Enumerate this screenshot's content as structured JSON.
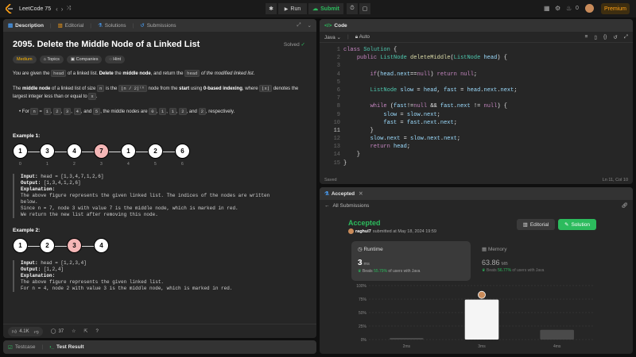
{
  "topbar": {
    "app_title": "LeetCode 75",
    "run_label": "Run",
    "submit_label": "Submit",
    "premium_label": "Premium",
    "avatar_count": "0"
  },
  "description_panel": {
    "tabs": [
      "Description",
      "Editorial",
      "Solutions",
      "Submissions"
    ],
    "title": "2095. Delete the Middle Node of a Linked List",
    "solved_label": "Solved",
    "chips": [
      "Medium",
      "Topics",
      "Companies",
      "Hint"
    ],
    "para1": {
      "t1": "You are given the ",
      "c1": "head",
      "t2": " of a linked list. ",
      "b1": "Delete",
      "t3": " the ",
      "b2": "middle node",
      "t4": ", and return the ",
      "c2": "head",
      "t5": " of the modified linked list."
    },
    "para2": {
      "t1": "The ",
      "b1": "middle node",
      "t2": " of a linked list of size ",
      "c1": "n",
      "t3": " is the ",
      "c2": "⌊n / 2⌋ᵗʰ",
      "t4": " node from the ",
      "b2": "start",
      "t5": " using ",
      "b3": "0-based indexing",
      "t6": ", where ",
      "c3": "⌊x⌋",
      "t7": " denotes the largest integer less than or equal to ",
      "c4": "x",
      "t8": "."
    },
    "bullet": {
      "t1": "For ",
      "c1": "n",
      "t2": " = ",
      "c2": "1",
      "c3": "2",
      "c4": "3",
      "c5": "4",
      "t3": ", and ",
      "c6": "5",
      "t4": ", the middle nodes are ",
      "c7": "0",
      "c8": "1",
      "c9": "1",
      "c10": "2",
      "t5": ", and ",
      "c11": "2",
      "t6": ", respectively."
    },
    "example1": {
      "title": "Example 1:",
      "nodes": [
        "1",
        "3",
        "4",
        "7",
        "1",
        "2",
        "6"
      ],
      "indices": [
        "0",
        "1",
        "2",
        "3",
        "4",
        "5",
        "6"
      ],
      "input_label": "Input:",
      "input_val": " head = [1,3,4,7,1,2,6]",
      "output_label": "Output:",
      "output_val": " [1,3,4,1,2,6]",
      "explanation_label": "Explanation:",
      "explanation_lines": [
        "The above figure represents the given linked list. The indices of the nodes are written",
        "below.",
        "Since n = 7, node 3 with value 7 is the middle node, which is marked in red.",
        "We return the new list after removing this node."
      ]
    },
    "example2": {
      "title": "Example 2:",
      "nodes": [
        "1",
        "2",
        "3",
        "4"
      ],
      "input_label": "Input:",
      "input_val": " head = [1,2,3,4]",
      "output_label": "Output:",
      "output_val": " [1,2,4]",
      "explanation_label": "Explanation:",
      "explanation_lines": [
        "The above figure represents the given linked list.",
        "For n = 4, node 2 with value 3 is the middle node, which is marked in red."
      ]
    },
    "footer": {
      "likes": "4.1K",
      "comments": "37"
    }
  },
  "bottom_tabs": [
    "Testcase",
    "Test Result"
  ],
  "code_panel": {
    "title": "Code",
    "language": "Java",
    "auto_label": "Auto",
    "saved_label": "Saved",
    "cursor_pos": "Ln 11, Col 10",
    "lines": [
      "class Solution {",
      "    public ListNode deleteMiddle(ListNode head) {",
      "",
      "        if(head.next==null) return null;",
      "",
      "        ListNode slow = head, fast = head.next.next;",
      "",
      "        while (fast!=null && fast.next != null) {",
      "            slow = slow.next;",
      "            fast = fast.next.next;",
      "        }",
      "        slow.next = slow.next.next;",
      "        return head;",
      "    }",
      "}"
    ]
  },
  "result_panel": {
    "tab_label": "Accepted",
    "back_label": "All Submissions",
    "status": "Accepted",
    "user": "raghul7",
    "submitted_text": "submitted at May 18, 2024 19:59",
    "editorial_label": "Editorial",
    "solution_label": "Solution",
    "runtime": {
      "label": "Runtime",
      "value": "3",
      "unit": "ms",
      "beats_prefix": "Beats",
      "beats_pct": "55.79%",
      "beats_suffix": "of users with Java"
    },
    "memory": {
      "label": "Memory",
      "value": "63.86",
      "unit": "MB",
      "beats_prefix": "Beats",
      "beats_pct": "56.77%",
      "beats_suffix": "of users with Java"
    }
  },
  "chart_data": {
    "type": "bar",
    "categories": [
      "2ms",
      "3ms",
      "4ms"
    ],
    "values": [
      3,
      74,
      18
    ],
    "yticks": [
      "100%",
      "75%",
      "50%",
      "25%",
      "0%"
    ],
    "ylim": [
      0,
      100
    ],
    "highlight_index": 1
  },
  "colors": {
    "accent_green": "#2cbb5d",
    "medium_yellow": "#ffb800",
    "premium_orange": "#ffa116"
  }
}
